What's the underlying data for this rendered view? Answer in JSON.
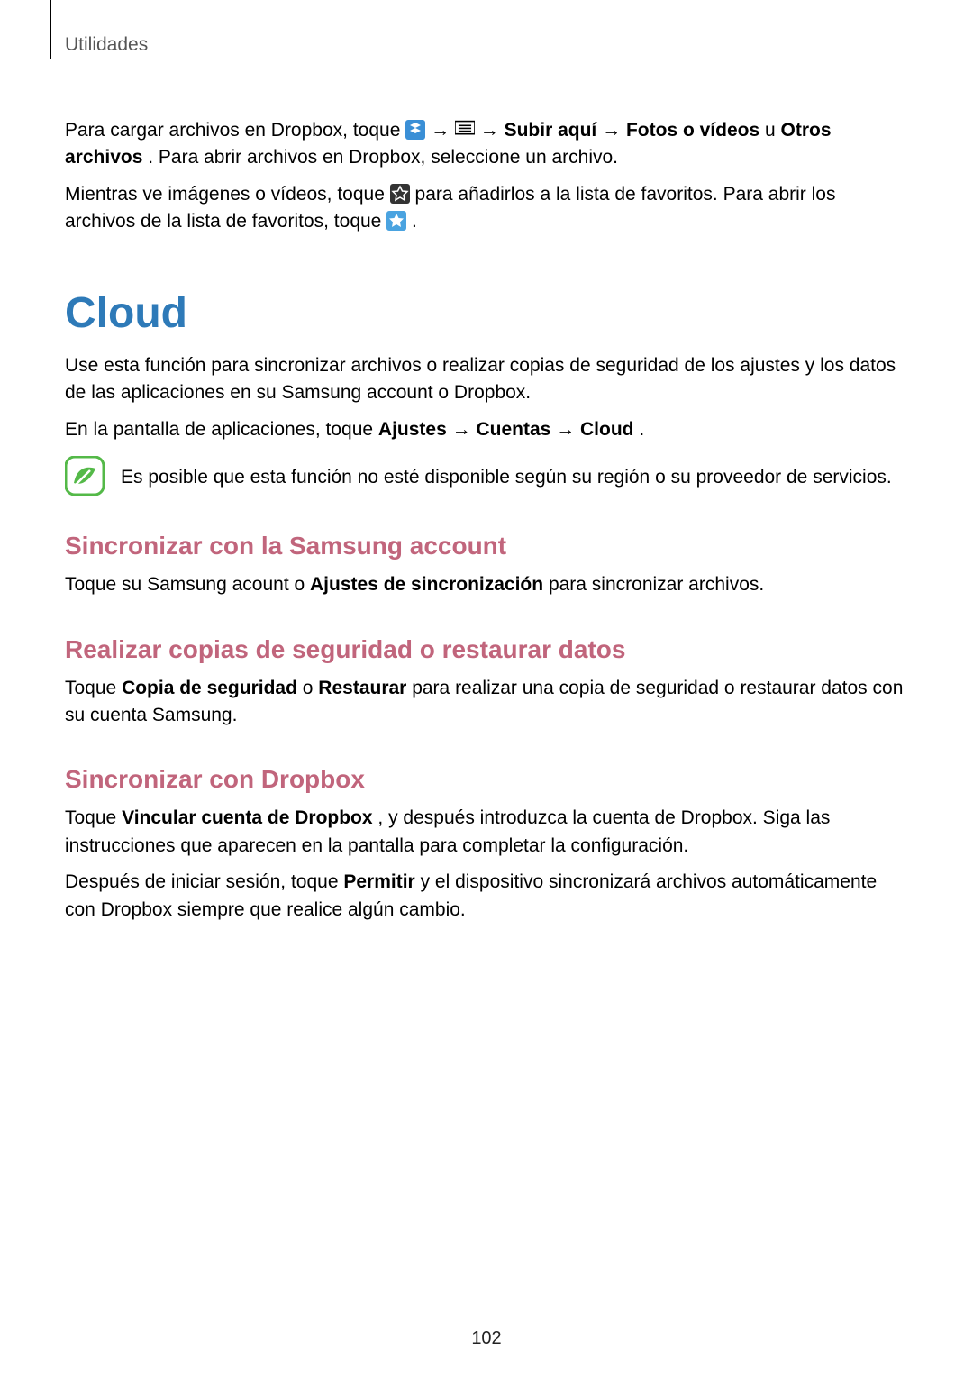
{
  "breadcrumb": "Utilidades",
  "p1": {
    "t1": "Para cargar archivos en Dropbox, toque ",
    "arrow1": " → ",
    "arrow2": " → ",
    "b1": "Subir aquí",
    "arrow3": " → ",
    "b2": "Fotos o vídeos",
    "t2": " u ",
    "b3": "Otros archivos",
    "t3": ". Para abrir archivos en Dropbox, seleccione un archivo."
  },
  "p2": {
    "t1": "Mientras ve imágenes o vídeos, toque ",
    "t2": " para añadirlos a la lista de favoritos. Para abrir los archivos de la lista de favoritos, toque ",
    "t3": "."
  },
  "cloud": {
    "heading": "Cloud",
    "p1": "Use esta función para sincronizar archivos o realizar copias de seguridad de los ajustes y los datos de las aplicaciones en su Samsung account o Dropbox.",
    "p2a": "En la pantalla de aplicaciones, toque ",
    "p2b1": "Ajustes",
    "arrow1": " → ",
    "p2b2": "Cuentas",
    "arrow2": " → ",
    "p2b3": "Cloud",
    "p2c": ".",
    "note": "Es posible que esta función no esté disponible según su región o su proveedor de servicios."
  },
  "sec1": {
    "heading": "Sincronizar con la Samsung account",
    "p1a": "Toque su Samsung acount o ",
    "p1b": "Ajustes de sincronización",
    "p1c": " para sincronizar archivos."
  },
  "sec2": {
    "heading": "Realizar copias de seguridad o restaurar datos",
    "p1a": "Toque ",
    "p1b1": "Copia de seguridad",
    "p1c": " o ",
    "p1b2": "Restaurar",
    "p1d": " para realizar una copia de seguridad o restaurar datos con su cuenta Samsung."
  },
  "sec3": {
    "heading": "Sincronizar con Dropbox",
    "p1a": "Toque ",
    "p1b": "Vincular cuenta de Dropbox",
    "p1c": ", y después introduzca la cuenta de Dropbox. Siga las instrucciones que aparecen en la pantalla para completar la configuración.",
    "p2a": "Después de iniciar sesión, toque ",
    "p2b": "Permitir",
    "p2c": " y el dispositivo sincronizará archivos automáticamente con Dropbox siempre que realice algún cambio."
  },
  "page_number": "102"
}
